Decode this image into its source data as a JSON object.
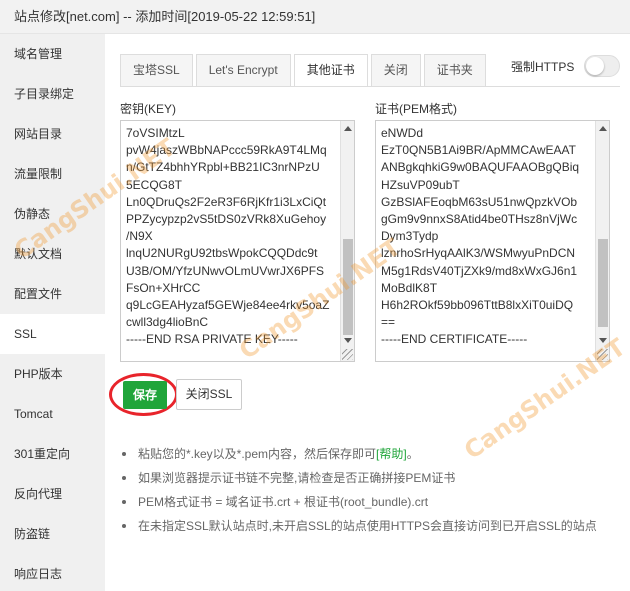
{
  "window": {
    "title": "站点修改[net.com] -- 添加时间[2019-05-22 12:59:51]"
  },
  "sidebar": {
    "items": [
      {
        "label": "域名管理"
      },
      {
        "label": "子目录绑定"
      },
      {
        "label": "网站目录"
      },
      {
        "label": "流量限制"
      },
      {
        "label": "伪静态"
      },
      {
        "label": "默认文档"
      },
      {
        "label": "配置文件"
      },
      {
        "label": "SSL",
        "active": true
      },
      {
        "label": "PHP版本"
      },
      {
        "label": "Tomcat"
      },
      {
        "label": "301重定向"
      },
      {
        "label": "反向代理"
      },
      {
        "label": "防盗链"
      },
      {
        "label": "响应日志"
      }
    ]
  },
  "tabs": [
    {
      "label": "宝塔SSL"
    },
    {
      "label": "Let's Encrypt"
    },
    {
      "label": "其他证书",
      "active": true
    },
    {
      "label": "关闭"
    },
    {
      "label": "证书夹"
    }
  ],
  "https_toggle": {
    "label": "强制HTTPS",
    "on": false
  },
  "key_field": {
    "label": "密钥(KEY)",
    "lines": [
      "7oVSIMtzL",
      "pvW4jaszWBbNAPccc59RkA9T4LMq",
      "n/GtTZ4bhhYRpbl+BB21IC3nrNPzU",
      "5ECQG8T",
      "Ln0QDruQs2F2eR3F6RjKfr1i3LxCiQt",
      "PPZycypzp2vS5tDS0zVRk8XuGehoy",
      "/N9X",
      "lnqU2NURgU92tbsWpokCQQDdc9t",
      "U3B/OM/YfzUNwvOLmUVwrJX6PFS",
      "FsOn+XHrCC",
      "q9LcGEAHyzaf5GEWje84ee4rkv5oaZ",
      "cwll3dg4lioBnC",
      "-----END RSA PRIVATE KEY-----"
    ]
  },
  "cert_field": {
    "label": "证书(PEM格式)",
    "lines": [
      "eNWDd",
      "EzT0QN5B1Ai9BR/ApMMCAwEAAT",
      "ANBgkqhkiG9w0BAQUFAAOBgQBiq",
      "HZsuVP09ubT",
      "GzBSlAFEoqbM63sU51nwQpzkVOb",
      "gGm9v9nnxS8Atid4be0THsz8nVjWc",
      "Dym3Tydp",
      "lznrhoSrHyqAAlK3/WSMwyuPnDCN",
      "M5g1RdsV40TjZXk9/md8xWxGJ6n1",
      "MoBdlK8T",
      "H6h2ROkf59bb096TttB8lxXiT0uiDQ",
      "==",
      "-----END CERTIFICATE-----"
    ]
  },
  "buttons": {
    "save": "保存",
    "close_ssl": "关闭SSL"
  },
  "tips": {
    "t1_prefix": "粘贴您的*.key以及*.pem内容，然后保存即可",
    "t1_link": "[帮助]",
    "t1_suffix": "。",
    "t2": "如果浏览器提示证书链不完整,请检查是否正确拼接PEM证书",
    "t3": "PEM格式证书 = 域名证书.crt + 根证书(root_bundle).crt",
    "t4": "在未指定SSL默认站点时,未开启SSL的站点使用HTTPS会直接访问到已开启SSL的站点"
  },
  "watermark": {
    "text": "CangShui.NET"
  },
  "colors": {
    "accent": "#20a53a",
    "highlight": "#e8242b",
    "watermark": "#f09628"
  }
}
